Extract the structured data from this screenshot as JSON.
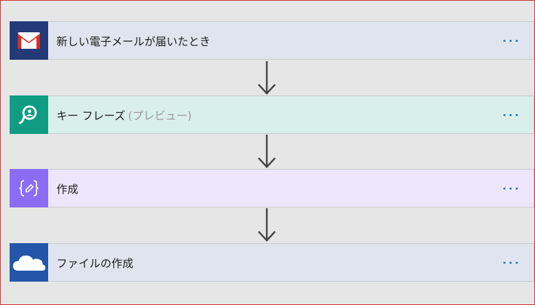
{
  "steps": [
    {
      "label": "新しい電子メールが届いたとき",
      "sublabel": "",
      "icon": "gmail-icon",
      "icon_bg": "#233a78",
      "card_bg": "#dfe4ee"
    },
    {
      "label": "キー フレーズ",
      "sublabel": "(プレビュー)",
      "icon": "text-analytics-icon",
      "icon_bg": "#0f9c82",
      "card_bg": "#d9efea"
    },
    {
      "label": "作成",
      "sublabel": "",
      "icon": "compose-icon",
      "icon_bg": "#8b6cf7",
      "card_bg": "#ece5fc"
    },
    {
      "label": "ファイルの作成",
      "sublabel": "",
      "icon": "onedrive-icon",
      "icon_bg": "#2455a8",
      "card_bg": "#dfe4ee"
    }
  ],
  "colors": {
    "more_dots": "#1a6fd0",
    "arrow": "#444444",
    "frame_border": "#d62828"
  }
}
